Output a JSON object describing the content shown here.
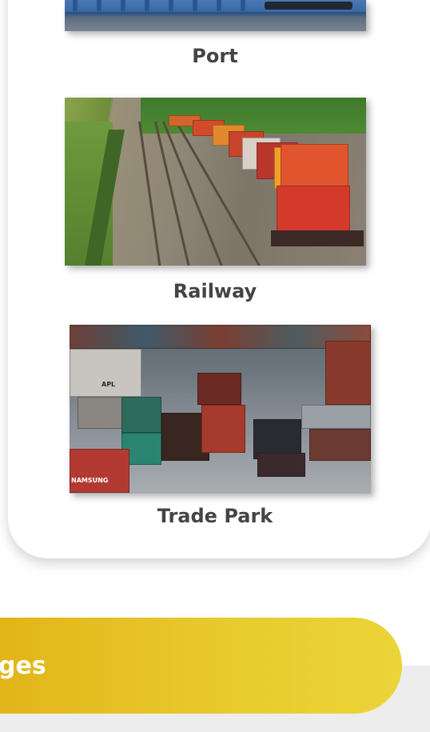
{
  "gallery": {
    "items": [
      {
        "caption": "Port",
        "photo": "port-photo"
      },
      {
        "caption": "Railway",
        "photo": "railway-photo"
      },
      {
        "caption": "Trade Park",
        "photo": "trade-park-photo"
      }
    ]
  },
  "banner": {
    "title": "ges"
  },
  "colors": {
    "banner_start": "#e2b51a",
    "banner_end": "#ebd438",
    "caption": "#444444"
  }
}
